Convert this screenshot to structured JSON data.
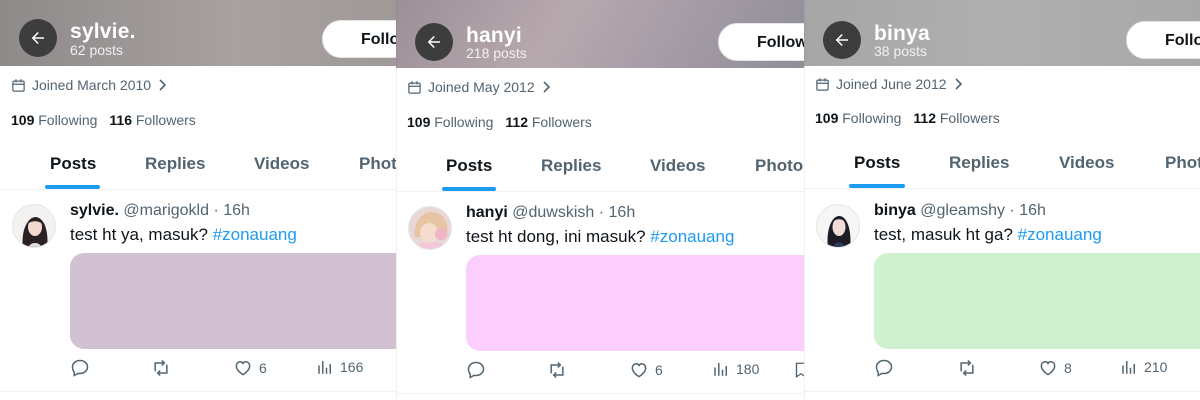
{
  "panels": [
    {
      "header": {
        "name": "sylvie.",
        "posts": "62 posts",
        "follow_label": "Follow",
        "bg": "#9a9494"
      },
      "joined": "Joined March 2010",
      "following_count": "109",
      "following_label": "Following",
      "followers_count": "116",
      "followers_label": "Followers",
      "tabs": [
        "Posts",
        "Replies",
        "Videos",
        "Photos"
      ],
      "active_tab": "Posts",
      "tweet": {
        "name": "sylvie.",
        "handle": "@marigokld",
        "time": "16h",
        "text": "test ht ya, masuk?",
        "hashtag": "#zonauang",
        "media_color": "#d2c0d3",
        "likes": "6",
        "views": "166"
      }
    },
    {
      "header": {
        "name": "hanyi",
        "posts": "218 posts",
        "follow_label": "Follow",
        "bg": "#a59a9e"
      },
      "joined": "Joined May 2012",
      "following_count": "109",
      "following_label": "Following",
      "followers_count": "112",
      "followers_label": "Followers",
      "tabs": [
        "Posts",
        "Replies",
        "Videos",
        "Photos"
      ],
      "active_tab": "Posts",
      "tweet": {
        "name": "hanyi",
        "handle": "@duwskish",
        "time": "16h",
        "text": "test ht dong, ini masuk?",
        "hashtag": "#zonauang",
        "media_color": "#fccefd",
        "likes": "6",
        "views": "180"
      }
    },
    {
      "header": {
        "name": "binya",
        "posts": "38 posts",
        "follow_label": "Follow",
        "bg": "#aaa9a9"
      },
      "joined": "Joined June 2012",
      "following_count": "109",
      "following_label": "Following",
      "followers_count": "112",
      "followers_label": "Followers",
      "tabs": [
        "Posts",
        "Replies",
        "Videos",
        "Photos"
      ],
      "active_tab": "Posts",
      "tweet": {
        "name": "binya",
        "handle": "@gleamshy",
        "time": "16h",
        "text": "test, masuk ht ga?",
        "hashtag": "#zonauang",
        "media_color": "#d0f1cf",
        "likes": "8",
        "views": "210"
      }
    }
  ],
  "colors": {
    "accent": "#1d9bf0",
    "text_primary": "#0f1419",
    "text_secondary": "#536471"
  },
  "icons": [
    "back-arrow-icon",
    "calendar-icon",
    "chevron-right-icon",
    "reply-icon",
    "repost-icon",
    "like-icon",
    "views-icon",
    "bookmark-icon"
  ]
}
